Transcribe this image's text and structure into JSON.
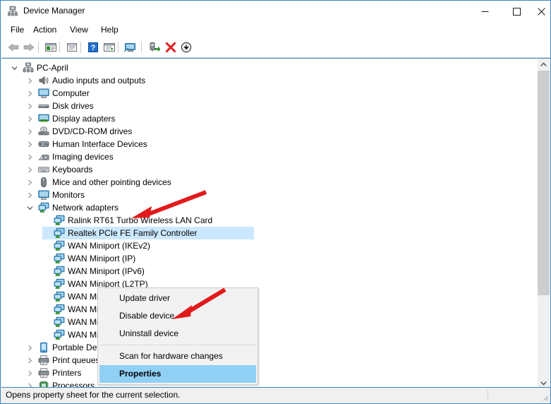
{
  "window": {
    "title": "Device Manager",
    "title_icon": "device-manager-icon",
    "controls": {
      "minimize": "minimize-icon",
      "maximize": "maximize-icon",
      "close": "close-icon"
    }
  },
  "menubar": {
    "items": [
      {
        "label": "File"
      },
      {
        "label": "Action"
      },
      {
        "label": "View"
      },
      {
        "label": "Help"
      }
    ]
  },
  "toolbar": {
    "buttons": [
      {
        "name": "back-icon",
        "tooltip": "Back"
      },
      {
        "name": "forward-icon",
        "tooltip": "Forward"
      },
      {
        "name": "show-hide-console-tree-icon",
        "tooltip": "Show/Hide Console Tree"
      },
      {
        "name": "properties-icon",
        "tooltip": "Properties"
      },
      {
        "name": "help-icon",
        "tooltip": "Help"
      },
      {
        "name": "update-driver-icon",
        "tooltip": "Update Driver Software"
      },
      {
        "name": "scan-hardware-changes-icon",
        "tooltip": "Scan for hardware changes"
      },
      {
        "name": "enable-device-icon",
        "tooltip": "Enable device"
      },
      {
        "name": "uninstall-device-icon",
        "tooltip": "Uninstall device"
      },
      {
        "name": "disable-device-icon",
        "tooltip": "Disable device"
      }
    ]
  },
  "tree": {
    "rows": [
      {
        "label": "PC-April",
        "depth": 0,
        "twisty": "expanded",
        "icon": "computer-root-icon"
      },
      {
        "label": "Audio inputs and outputs",
        "depth": 1,
        "twisty": "collapsed",
        "icon": "speaker-icon"
      },
      {
        "label": "Computer",
        "depth": 1,
        "twisty": "collapsed",
        "icon": "monitor-icon"
      },
      {
        "label": "Disk drives",
        "depth": 1,
        "twisty": "collapsed",
        "icon": "disk-drive-icon"
      },
      {
        "label": "Display adapters",
        "depth": 1,
        "twisty": "collapsed",
        "icon": "display-adapter-icon"
      },
      {
        "label": "DVD/CD-ROM drives",
        "depth": 1,
        "twisty": "collapsed",
        "icon": "optical-drive-icon"
      },
      {
        "label": "Human Interface Devices",
        "depth": 1,
        "twisty": "collapsed",
        "icon": "hid-icon"
      },
      {
        "label": "Imaging devices",
        "depth": 1,
        "twisty": "collapsed",
        "icon": "camera-icon"
      },
      {
        "label": "Keyboards",
        "depth": 1,
        "twisty": "collapsed",
        "icon": "keyboard-icon"
      },
      {
        "label": "Mice and other pointing devices",
        "depth": 1,
        "twisty": "collapsed",
        "icon": "mouse-icon"
      },
      {
        "label": "Monitors",
        "depth": 1,
        "twisty": "collapsed",
        "icon": "monitor-icon"
      },
      {
        "label": "Network adapters",
        "depth": 1,
        "twisty": "expanded",
        "icon": "network-adapter-icon"
      },
      {
        "label": "Ralink RT61 Turbo Wireless LAN Card",
        "depth": 2,
        "twisty": "none",
        "icon": "network-adapter-icon"
      },
      {
        "label": "Realtek PCIe FE Family Controller",
        "depth": 2,
        "twisty": "none",
        "icon": "network-adapter-icon",
        "selected": true
      },
      {
        "label": "WAN Miniport (IKEv2)",
        "depth": 2,
        "twisty": "none",
        "icon": "network-adapter-icon"
      },
      {
        "label": "WAN Miniport (IP)",
        "depth": 2,
        "twisty": "none",
        "icon": "network-adapter-icon"
      },
      {
        "label": "WAN Miniport (IPv6)",
        "depth": 2,
        "twisty": "none",
        "icon": "network-adapter-icon"
      },
      {
        "label": "WAN Miniport (L2TP)",
        "depth": 2,
        "twisty": "none",
        "icon": "network-adapter-icon"
      },
      {
        "label": "WAN Miniport (Network Monitor)",
        "depth": 2,
        "twisty": "none",
        "icon": "network-adapter-icon"
      },
      {
        "label": "WAN Miniport (PPPOE)",
        "depth": 2,
        "twisty": "none",
        "icon": "network-adapter-icon"
      },
      {
        "label": "WAN Miniport (PPTP)",
        "depth": 2,
        "twisty": "none",
        "icon": "network-adapter-icon"
      },
      {
        "label": "WAN Miniport (SSTP)",
        "depth": 2,
        "twisty": "none",
        "icon": "network-adapter-icon"
      },
      {
        "label": "Portable Devices",
        "depth": 1,
        "twisty": "collapsed",
        "icon": "portable-device-icon"
      },
      {
        "label": "Print queues",
        "depth": 1,
        "twisty": "collapsed",
        "icon": "printer-icon"
      },
      {
        "label": "Printers",
        "depth": 1,
        "twisty": "collapsed",
        "icon": "printer-icon"
      },
      {
        "label": "Processors",
        "depth": 1,
        "twisty": "collapsed",
        "icon": "processor-icon"
      }
    ]
  },
  "context_menu": {
    "items": [
      {
        "label": "Update driver",
        "type": "item"
      },
      {
        "label": "Disable device",
        "type": "item"
      },
      {
        "label": "Uninstall device",
        "type": "item"
      },
      {
        "label": "",
        "type": "separator"
      },
      {
        "label": "Scan for hardware changes",
        "type": "item"
      },
      {
        "label": "Properties",
        "type": "item",
        "highlighted": true
      }
    ]
  },
  "annotations": [
    {
      "name": "arrow-to-network-adapters",
      "color": "#e11b1b"
    },
    {
      "name": "arrow-to-properties",
      "color": "#e11b1b"
    }
  ],
  "statusbar": {
    "text": "Opens property sheet for the current selection."
  },
  "scrollbar": {
    "up_icon": "chevron-up-icon",
    "down_icon": "chevron-down-icon"
  },
  "colors": {
    "selection": "#cce8ff",
    "menu_highlight": "#91d0f5",
    "window_border": "#3b87c4",
    "annotation_red": "#e11b1b"
  }
}
